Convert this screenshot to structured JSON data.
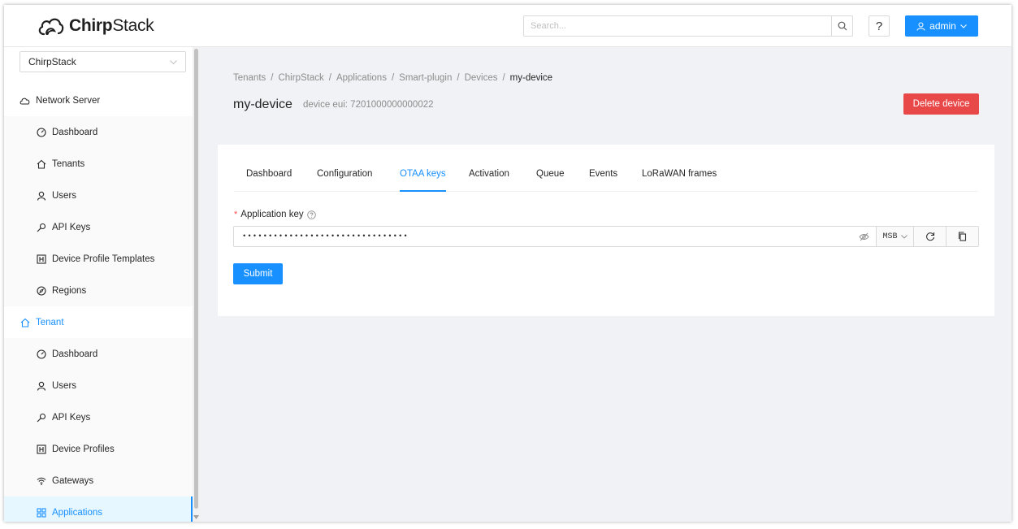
{
  "header": {
    "logo_text_bold": "Chirp",
    "logo_text_rest": "Stack",
    "search_placeholder": "Search...",
    "help_label": "?",
    "user_label": "admin"
  },
  "sidebar": {
    "tenant_select_value": "ChirpStack",
    "network_server_label": "Network Server",
    "network_items": [
      {
        "label": "Dashboard",
        "icon": "dashboard-icon"
      },
      {
        "label": "Tenants",
        "icon": "home-icon"
      },
      {
        "label": "Users",
        "icon": "user-icon"
      },
      {
        "label": "API Keys",
        "icon": "key-icon"
      },
      {
        "label": "Device Profile Templates",
        "icon": "profile-icon"
      },
      {
        "label": "Regions",
        "icon": "compass-icon"
      }
    ],
    "tenant_label": "Tenant",
    "tenant_items": [
      {
        "label": "Dashboard",
        "icon": "dashboard-icon"
      },
      {
        "label": "Users",
        "icon": "user-icon"
      },
      {
        "label": "API Keys",
        "icon": "key-icon"
      },
      {
        "label": "Device Profiles",
        "icon": "profile-icon"
      },
      {
        "label": "Gateways",
        "icon": "wifi-icon"
      },
      {
        "label": "Applications",
        "icon": "apps-icon"
      }
    ]
  },
  "breadcrumb": [
    "Tenants",
    "ChirpStack",
    "Applications",
    "Smart-plugin",
    "Devices",
    "my-device"
  ],
  "page": {
    "title": "my-device",
    "subtitle": "device eui: 7201000000000022",
    "delete_label": "Delete device"
  },
  "tabs": [
    "Dashboard",
    "Configuration",
    "OTAA keys",
    "Activation",
    "Queue",
    "Events",
    "LoRaWAN frames"
  ],
  "active_tab": "OTAA keys",
  "form": {
    "field_label": "Application key",
    "required_mark": "*",
    "key_masked": "••••••••••••••••••••••••••••••••",
    "byte_order": "MSB",
    "submit_label": "Submit"
  },
  "colors": {
    "primary": "#1890ff",
    "danger": "#e84848",
    "background": "#f0f2f5"
  }
}
